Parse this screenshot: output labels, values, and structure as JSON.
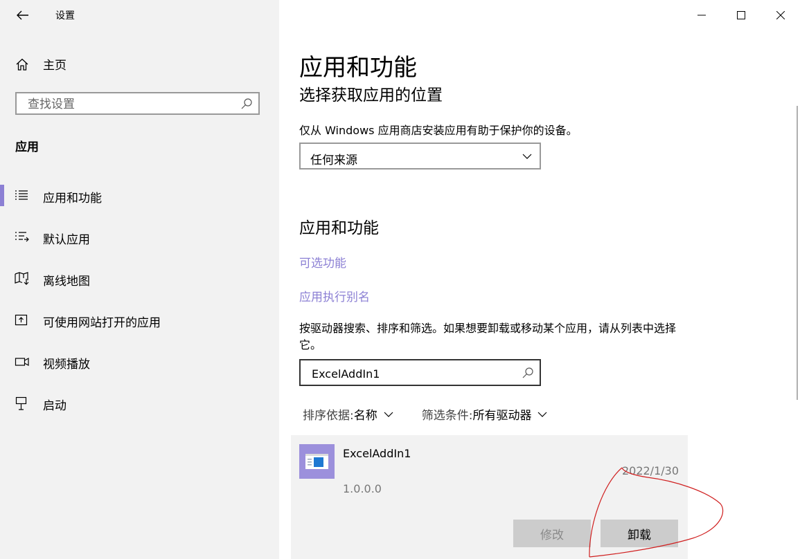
{
  "window": {
    "title": "设置"
  },
  "sidebar": {
    "home_label": "主页",
    "search_placeholder": "查找设置",
    "section_label": "应用",
    "items": [
      {
        "label": "应用和功能",
        "icon": "apps-features-icon",
        "selected": true
      },
      {
        "label": "默认应用",
        "icon": "default-apps-icon",
        "selected": false
      },
      {
        "label": "离线地图",
        "icon": "offline-maps-icon",
        "selected": false
      },
      {
        "label": "可使用网站打开的应用",
        "icon": "apps-for-websites-icon",
        "selected": false
      },
      {
        "label": "视频播放",
        "icon": "video-playback-icon",
        "selected": false
      },
      {
        "label": "启动",
        "icon": "startup-icon",
        "selected": false
      }
    ]
  },
  "main": {
    "title": "应用和功能",
    "install_source": {
      "title": "选择获取应用的位置",
      "description": "仅从 Windows 应用商店安装应用有助于保护你的设备。",
      "selected": "任何来源"
    },
    "apps_section": {
      "title": "应用和功能",
      "link_optional_features": "可选功能",
      "link_app_aliases": "应用执行别名",
      "help_text": "按驱动器搜索、排序和筛选。如果想要卸载或移动某个应用，请从列表中选择它。",
      "search_value": "ExcelAddIn1",
      "sort_label": "排序依据:",
      "sort_value": "名称",
      "filter_label": "筛选条件:",
      "filter_value": "所有驱动器"
    },
    "app_item": {
      "name": "ExcelAddIn1",
      "date": "2022/1/30",
      "version": "1.0.0.0",
      "modify_label": "修改",
      "uninstall_label": "卸载"
    }
  },
  "colors": {
    "accent": "#8c80d4",
    "sidebar_bg": "#f2f2f2",
    "card_bg": "#f2f2f2",
    "annotation": "#d02020"
  }
}
